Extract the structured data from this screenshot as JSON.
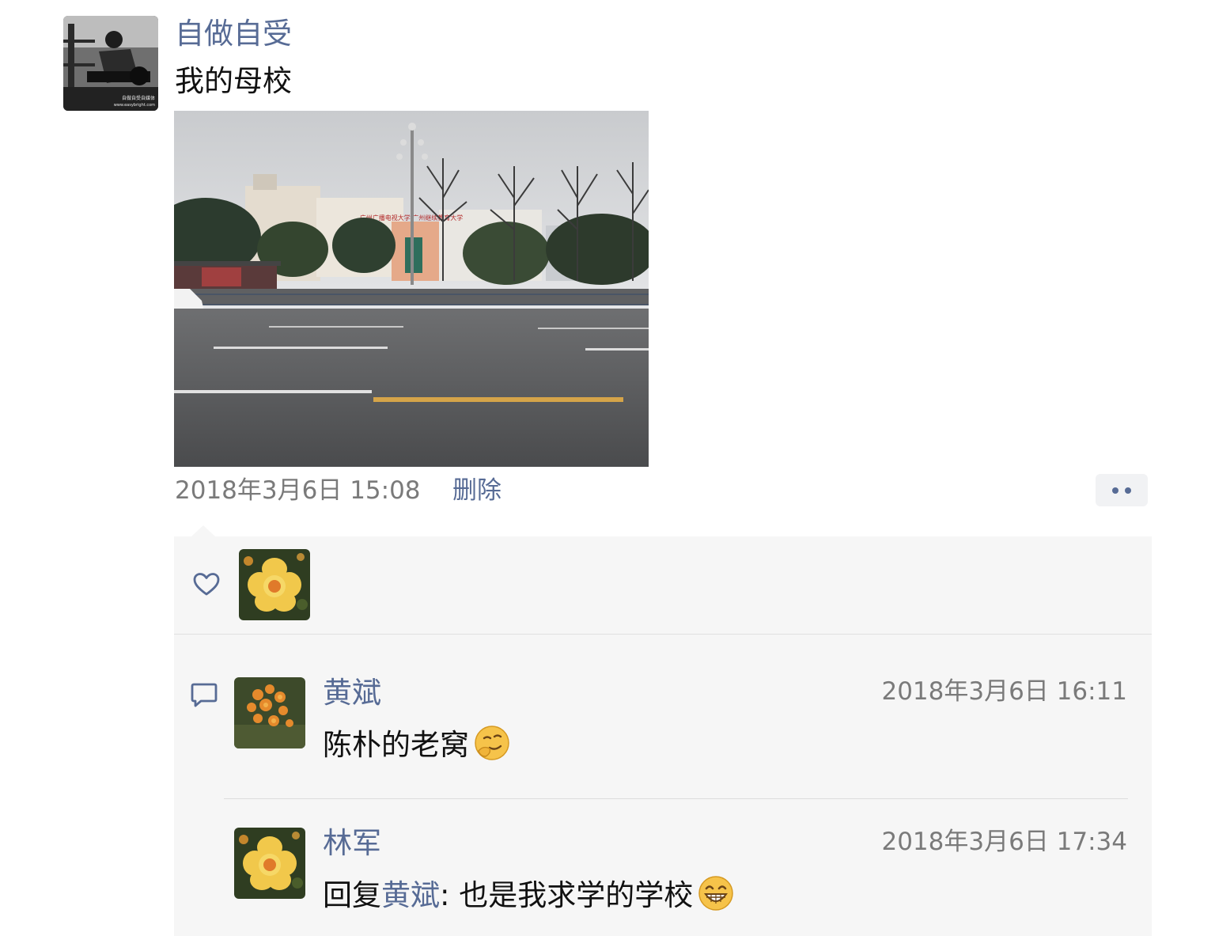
{
  "post": {
    "author": "自做自受",
    "author_avatar": "black-and-white-photo-avatar",
    "avatar_caption_line1": "自做自受自媒体",
    "avatar_caption_line2": "www.easybright.com",
    "text": "我的母校",
    "photo": "street-view-photo",
    "photo_sign_text": "广州广播电视大学·广州继续教育大学",
    "time": "2018年3月6日 15:08",
    "delete_label": "删除",
    "more_icon": "two-dots-icon"
  },
  "likes": {
    "icon": "heart-outline-icon",
    "users": [
      {
        "avatar": "yellow-flower-avatar"
      }
    ]
  },
  "comments": {
    "icon": "speech-bubble-icon",
    "items": [
      {
        "name": "黄斌",
        "time": "2018年3月6日 16:11",
        "text": "陈朴的老窝",
        "emoji": "thinking-smirk-emoji",
        "avatar": "orange-flowers-avatar"
      },
      {
        "name": "林军",
        "time": "2018年3月6日 17:34",
        "reply_prefix": "回复",
        "reply_to": "黄斌",
        "text": ": 也是我求学的学校",
        "emoji": "grinning-emoji",
        "avatar": "yellow-flower-avatar"
      }
    ]
  },
  "colors": {
    "link": "#576b95",
    "panel_bg": "#f6f6f6",
    "secondary_text": "#7a7a7a",
    "primary_text": "#111111"
  }
}
